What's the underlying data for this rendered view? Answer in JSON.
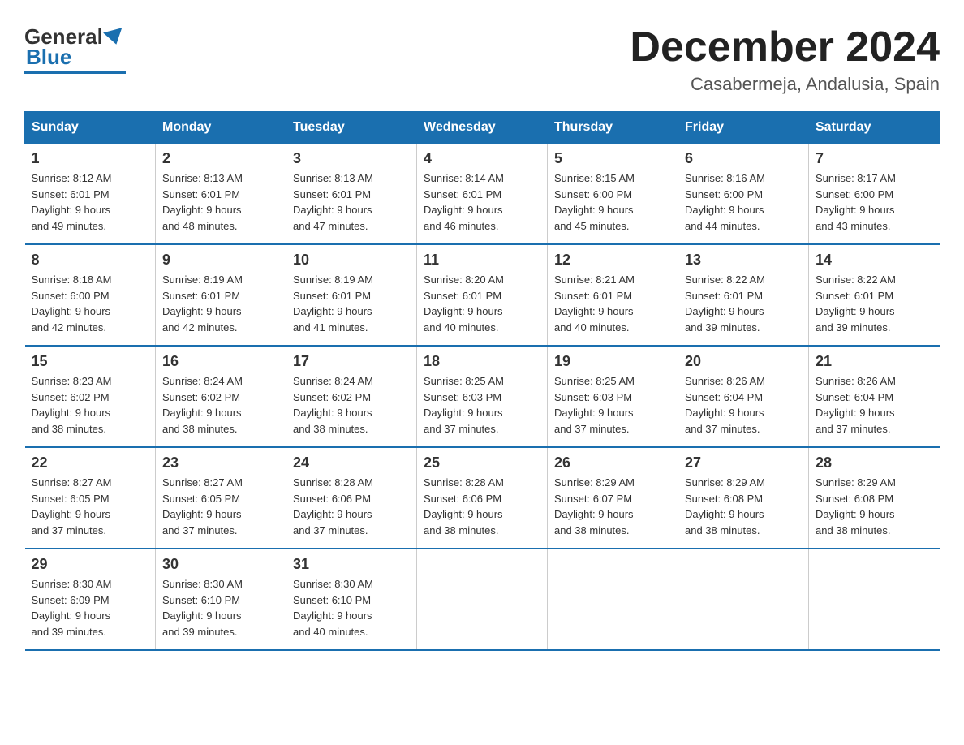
{
  "header": {
    "logo": {
      "general": "General",
      "blue": "Blue"
    },
    "title": "December 2024",
    "location": "Casabermeja, Andalusia, Spain"
  },
  "days_of_week": [
    "Sunday",
    "Monday",
    "Tuesday",
    "Wednesday",
    "Thursday",
    "Friday",
    "Saturday"
  ],
  "weeks": [
    [
      {
        "day": "1",
        "sunrise": "8:12 AM",
        "sunset": "6:01 PM",
        "daylight": "9 hours and 49 minutes."
      },
      {
        "day": "2",
        "sunrise": "8:13 AM",
        "sunset": "6:01 PM",
        "daylight": "9 hours and 48 minutes."
      },
      {
        "day": "3",
        "sunrise": "8:13 AM",
        "sunset": "6:01 PM",
        "daylight": "9 hours and 47 minutes."
      },
      {
        "day": "4",
        "sunrise": "8:14 AM",
        "sunset": "6:01 PM",
        "daylight": "9 hours and 46 minutes."
      },
      {
        "day": "5",
        "sunrise": "8:15 AM",
        "sunset": "6:00 PM",
        "daylight": "9 hours and 45 minutes."
      },
      {
        "day": "6",
        "sunrise": "8:16 AM",
        "sunset": "6:00 PM",
        "daylight": "9 hours and 44 minutes."
      },
      {
        "day": "7",
        "sunrise": "8:17 AM",
        "sunset": "6:00 PM",
        "daylight": "9 hours and 43 minutes."
      }
    ],
    [
      {
        "day": "8",
        "sunrise": "8:18 AM",
        "sunset": "6:00 PM",
        "daylight": "9 hours and 42 minutes."
      },
      {
        "day": "9",
        "sunrise": "8:19 AM",
        "sunset": "6:01 PM",
        "daylight": "9 hours and 42 minutes."
      },
      {
        "day": "10",
        "sunrise": "8:19 AM",
        "sunset": "6:01 PM",
        "daylight": "9 hours and 41 minutes."
      },
      {
        "day": "11",
        "sunrise": "8:20 AM",
        "sunset": "6:01 PM",
        "daylight": "9 hours and 40 minutes."
      },
      {
        "day": "12",
        "sunrise": "8:21 AM",
        "sunset": "6:01 PM",
        "daylight": "9 hours and 40 minutes."
      },
      {
        "day": "13",
        "sunrise": "8:22 AM",
        "sunset": "6:01 PM",
        "daylight": "9 hours and 39 minutes."
      },
      {
        "day": "14",
        "sunrise": "8:22 AM",
        "sunset": "6:01 PM",
        "daylight": "9 hours and 39 minutes."
      }
    ],
    [
      {
        "day": "15",
        "sunrise": "8:23 AM",
        "sunset": "6:02 PM",
        "daylight": "9 hours and 38 minutes."
      },
      {
        "day": "16",
        "sunrise": "8:24 AM",
        "sunset": "6:02 PM",
        "daylight": "9 hours and 38 minutes."
      },
      {
        "day": "17",
        "sunrise": "8:24 AM",
        "sunset": "6:02 PM",
        "daylight": "9 hours and 38 minutes."
      },
      {
        "day": "18",
        "sunrise": "8:25 AM",
        "sunset": "6:03 PM",
        "daylight": "9 hours and 37 minutes."
      },
      {
        "day": "19",
        "sunrise": "8:25 AM",
        "sunset": "6:03 PM",
        "daylight": "9 hours and 37 minutes."
      },
      {
        "day": "20",
        "sunrise": "8:26 AM",
        "sunset": "6:04 PM",
        "daylight": "9 hours and 37 minutes."
      },
      {
        "day": "21",
        "sunrise": "8:26 AM",
        "sunset": "6:04 PM",
        "daylight": "9 hours and 37 minutes."
      }
    ],
    [
      {
        "day": "22",
        "sunrise": "8:27 AM",
        "sunset": "6:05 PM",
        "daylight": "9 hours and 37 minutes."
      },
      {
        "day": "23",
        "sunrise": "8:27 AM",
        "sunset": "6:05 PM",
        "daylight": "9 hours and 37 minutes."
      },
      {
        "day": "24",
        "sunrise": "8:28 AM",
        "sunset": "6:06 PM",
        "daylight": "9 hours and 37 minutes."
      },
      {
        "day": "25",
        "sunrise": "8:28 AM",
        "sunset": "6:06 PM",
        "daylight": "9 hours and 38 minutes."
      },
      {
        "day": "26",
        "sunrise": "8:29 AM",
        "sunset": "6:07 PM",
        "daylight": "9 hours and 38 minutes."
      },
      {
        "day": "27",
        "sunrise": "8:29 AM",
        "sunset": "6:08 PM",
        "daylight": "9 hours and 38 minutes."
      },
      {
        "day": "28",
        "sunrise": "8:29 AM",
        "sunset": "6:08 PM",
        "daylight": "9 hours and 38 minutes."
      }
    ],
    [
      {
        "day": "29",
        "sunrise": "8:30 AM",
        "sunset": "6:09 PM",
        "daylight": "9 hours and 39 minutes."
      },
      {
        "day": "30",
        "sunrise": "8:30 AM",
        "sunset": "6:10 PM",
        "daylight": "9 hours and 39 minutes."
      },
      {
        "day": "31",
        "sunrise": "8:30 AM",
        "sunset": "6:10 PM",
        "daylight": "9 hours and 40 minutes."
      },
      {
        "day": "",
        "sunrise": "",
        "sunset": "",
        "daylight": ""
      },
      {
        "day": "",
        "sunrise": "",
        "sunset": "",
        "daylight": ""
      },
      {
        "day": "",
        "sunrise": "",
        "sunset": "",
        "daylight": ""
      },
      {
        "day": "",
        "sunrise": "",
        "sunset": "",
        "daylight": ""
      }
    ]
  ],
  "labels": {
    "sunrise": "Sunrise:",
    "sunset": "Sunset:",
    "daylight": "Daylight:"
  }
}
